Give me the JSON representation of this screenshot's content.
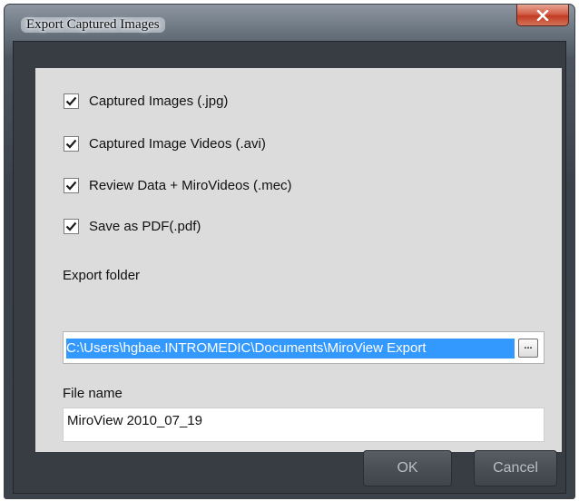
{
  "window": {
    "title": "Export Captured Images",
    "close_icon": "close-icon"
  },
  "options": [
    {
      "label": "Captured Images (.jpg)",
      "checked": true
    },
    {
      "label": "Captured Image Videos (.avi)",
      "checked": true
    },
    {
      "label": "Review Data + MiroVideos (.mec)",
      "checked": true
    },
    {
      "label": "Save as PDF(.pdf)",
      "checked": true
    }
  ],
  "export_folder": {
    "label": "Export folder",
    "value": "C:\\Users\\hgbae.INTROMEDIC\\Documents\\MiroView Export",
    "browse_label": "..."
  },
  "file_name": {
    "label": "File name",
    "value": "MiroView 2010_07_19"
  },
  "buttons": {
    "ok": "OK",
    "cancel": "Cancel"
  },
  "colors": {
    "selection": "#3399ff",
    "client_bg": "#383c43",
    "panel_bg": "#dcdcdc"
  }
}
